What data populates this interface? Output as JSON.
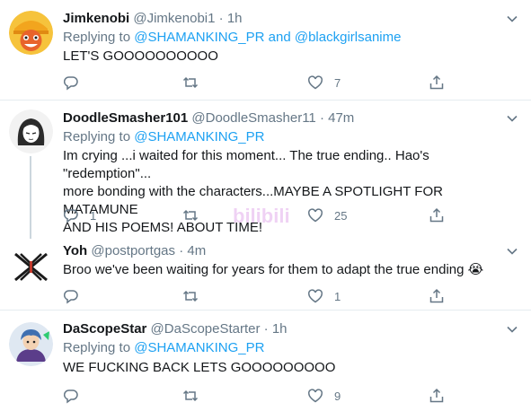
{
  "tweets": [
    {
      "name": "Jimkenobi",
      "handle": "@Jimkenobi1",
      "time": "1h",
      "replying_label": "Replying to",
      "replying_to": [
        "@SHAMANKING_PR",
        "@blackgirlsanime"
      ],
      "replying_and": "and",
      "text": "LET'S GOOOOOOOOOO",
      "replies": "",
      "retweets": "",
      "likes": "7"
    },
    {
      "name": "DoodleSmasher101",
      "handle": "@DoodleSmasher11",
      "time": "47m",
      "replying_label": "Replying to",
      "replying_to": [
        "@SHAMANKING_PR"
      ],
      "text_lines": [
        "Im crying ...i waited for this moment... The true ending.. Hao's \"redemption\"...",
        "more bonding with the characters...MAYBE A SPOTLIGHT FOR MATAMUNE",
        "AND HIS POEMS! ABOUT TIME!"
      ],
      "replies": "1",
      "retweets": "",
      "likes": "25"
    },
    {
      "name": "Yoh",
      "handle": "@postportgas",
      "time": "4m",
      "text": "Broo we've been waiting for years for them to adapt the true ending 😭",
      "replies": "",
      "retweets": "",
      "likes": "1"
    },
    {
      "name": "DaScopeStar",
      "handle": "@DaScopeStarter",
      "time": "1h",
      "replying_label": "Replying to",
      "replying_to": [
        "@SHAMANKING_PR"
      ],
      "text": "WE FUCKING BACK LETS GOOOOOOOOO",
      "replies": "",
      "retweets": "",
      "likes": "9"
    }
  ],
  "meta_separator": "·",
  "watermark_text": "bilibili",
  "colors": {
    "text": "#14171a",
    "secondary": "#657786",
    "link": "#1da1f2",
    "border": "#e6ecf0",
    "thread": "#ccd6dd"
  },
  "icons": [
    "reply-icon",
    "retweet-icon",
    "like-icon",
    "share-icon",
    "caret-down-icon"
  ]
}
